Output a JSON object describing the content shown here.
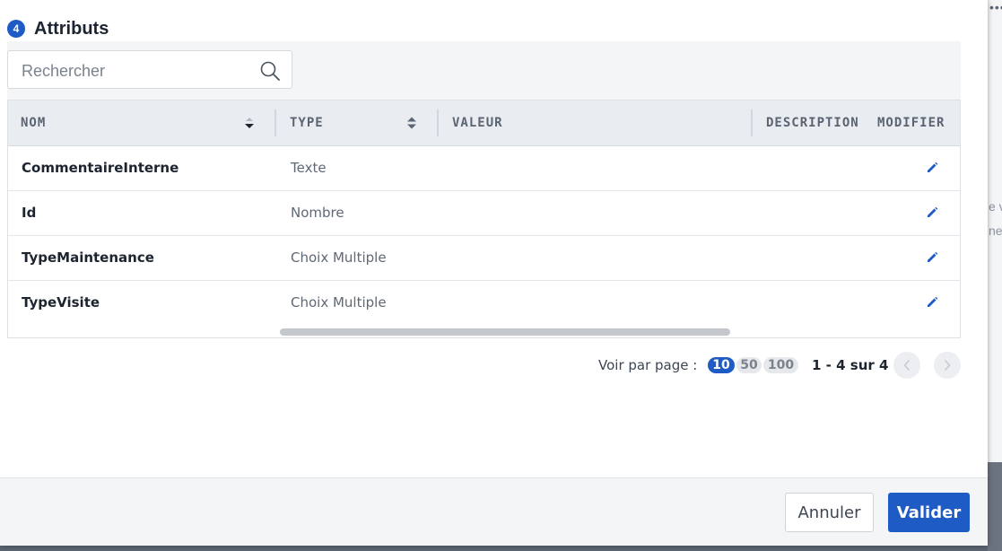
{
  "background": {
    "dots": "••••",
    "fragment_1": "e v",
    "fragment_2": "ne"
  },
  "section": {
    "step": "4",
    "title": "Attributs"
  },
  "search": {
    "placeholder": "Rechercher",
    "value": ""
  },
  "table": {
    "columns": {
      "name": "NOM",
      "type": "TYPE",
      "value": "VALEUR",
      "description": "DESCRIPTION",
      "edit": "MODIFIER"
    },
    "rows": [
      {
        "name": "CommentaireInterne",
        "type": "Texte"
      },
      {
        "name": "Id",
        "type": "Nombre"
      },
      {
        "name": "TypeMaintenance",
        "type": "Choix Multiple"
      },
      {
        "name": "TypeVisite",
        "type": "Choix Multiple"
      }
    ]
  },
  "pagination": {
    "per_page_label": "Voir par page :",
    "options": [
      "10",
      "50",
      "100"
    ],
    "selected": "10",
    "range": "1 - 4 sur 4"
  },
  "footer": {
    "cancel_label": "Annuler",
    "ok_label": "Valider"
  },
  "colors": {
    "accent": "#1f5bc5",
    "header_bg": "#e9ecf0",
    "panel_bg": "#f4f5f7"
  }
}
